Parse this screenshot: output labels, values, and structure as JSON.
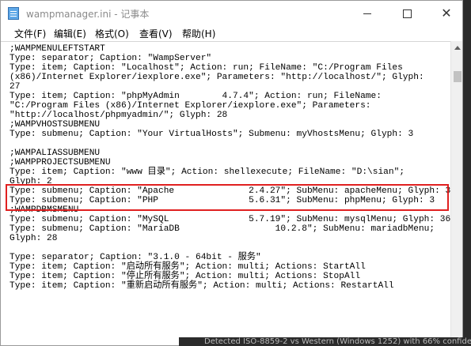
{
  "window": {
    "title": "wampmanager.ini - 记事本",
    "icon": "notepad-icon"
  },
  "menu": [
    {
      "label": "文件(F)"
    },
    {
      "label": "编辑(E)"
    },
    {
      "label": "格式(O)"
    },
    {
      "label": "查看(V)"
    },
    {
      "label": "帮助(H)"
    }
  ],
  "lines": [
    ";WAMPMENULEFTSTART",
    "Type: separator; Caption: \"WampServer\"",
    "Type: item; Caption: \"Localhost\"; Action: run; FileName: \"C:/Program Files",
    "(x86)/Internet Explorer/iexplore.exe\"; Parameters: \"http://localhost/\"; Glyph:",
    "27",
    "Type: item; Caption: \"phpMyAdmin        4.7.4\"; Action: run; FileName:",
    "\"C:/Program Files (x86)/Internet Explorer/iexplore.exe\"; Parameters:",
    "\"http://localhost/phpmyadmin/\"; Glyph: 28",
    ";WAMPVHOSTSUBMENU",
    "Type: submenu; Caption: \"Your VirtualHosts\"; Submenu: myVhostsMenu; Glyph: 3",
    "",
    ";WAMPALIASSUBMENU",
    ";WAMPPROJECTSUBMENU",
    "Type: item; Caption: \"www 目录\"; Action: shellexecute; FileName: \"D:\\sian\";",
    "Glyph: 2",
    "Type: submenu; Caption: \"Apache              2.4.27\"; SubMenu: apacheMenu; Glyph: 3",
    "Type: submenu; Caption: \"PHP                 5.6.31\"; SubMenu: phpMenu; Glyph: 3",
    ";WAMPDBMSMENU",
    "Type: submenu; Caption: \"MySQL               5.7.19\"; SubMenu: mysqlMenu; Glyph: 36",
    "Type: submenu; Caption: \"MariaDB                  10.2.8\"; SubMenu: mariadbMenu;",
    "Glyph: 28",
    "",
    "Type: separator; Caption: \"3.1.0 - 64bit - 服务\"",
    "Type: item; Caption: \"启动所有服务\"; Action: multi; Actions: StartAll",
    "Type: item; Caption: \"停止所有服务\"; Action: multi; Actions: StopAll",
    "Type: item; Caption: \"重新启动所有服务\"; Action: multi; Actions: RestartAll"
  ],
  "background_text": "Detected ISO-8859-2 vs Western (Windows 1252) with 66% confide",
  "colors": {
    "highlight_border": "#e02020",
    "background": "#2b2b2b"
  }
}
